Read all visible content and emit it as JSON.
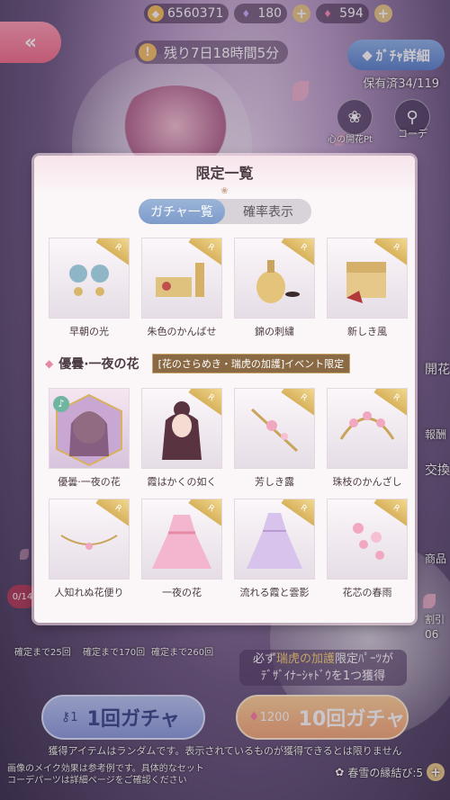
{
  "topbar": {
    "coins": "6560371",
    "crystal_blue": "180",
    "crystal_pink": "594"
  },
  "timer": {
    "text": "残り7日18時間5分"
  },
  "gacha_detail": {
    "label": "ｶﾞﾁｬ詳細"
  },
  "owned": {
    "text": "保有済34/119"
  },
  "side": {
    "heart_bloom": "心の開花Pt",
    "coordinate": "コーデ",
    "right_labels": [
      "開花",
      "報酬",
      "交換",
      "商品",
      "割引",
      "06"
    ]
  },
  "guarantee": [
    "確定まで25回",
    "確定まで170回",
    "確定まで260回"
  ],
  "left_pill": "0/14",
  "banner": {
    "line1_pre": "必ず",
    "line1_hl": "瑞虎の加護",
    "line1_post": "限定ﾊﾟｰﾂが",
    "line2": "ﾃﾞｻﾞｲﾅｰｼｬﾄﾞｳを1つ獲得"
  },
  "buttons": {
    "single": {
      "cost": "1",
      "label": "1回ガチャ"
    },
    "ten": {
      "cost": "1200",
      "label": "10回ガチャ"
    }
  },
  "disclaimer": "獲得アイテムはランダムです。表示されているものが獲得できるとは限りません",
  "footer": [
    "画像のメイク効果は参考例です。具体的なセット",
    "コーデパーツは詳細ページをご確認ください"
  ],
  "knot": "春雪の縁結び:5",
  "modal": {
    "title": "限定一覧",
    "tabs": [
      "ガチャ一覧",
      "確率表示"
    ],
    "row1": [
      "早朝の光",
      "朱色のかんばせ",
      "錦の刺繍",
      "新しき風"
    ],
    "section_title": "優曇·一夜の花",
    "section_event": "[花のさらめき・瑞虎の加護]イベント限定",
    "row2": [
      "優曇·一夜の花",
      "霞はかくの如く",
      "芳しき露",
      "珠枝のかんざし"
    ],
    "row3": [
      "人知れぬ花便り",
      "一夜の花",
      "流れる霞と雲影",
      "花芯の春雨"
    ],
    "rarity": "R"
  },
  "colors": {
    "accent_pink": "#f2708d",
    "gold": "#d8b25c",
    "blue": "#7d9bcb"
  }
}
